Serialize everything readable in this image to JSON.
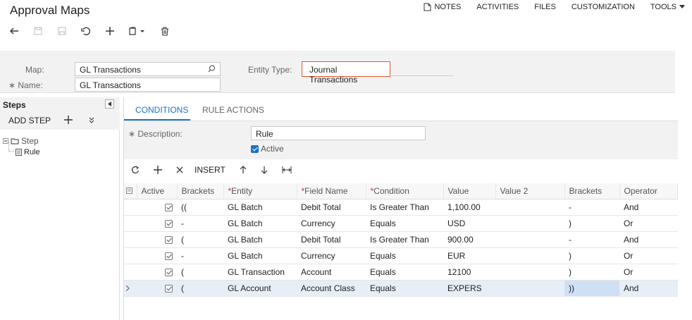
{
  "header": {
    "title": "Approval Maps",
    "menu": [
      "NOTES",
      "ACTIVITIES",
      "FILES",
      "CUSTOMIZATION",
      "TOOLS"
    ]
  },
  "form": {
    "map_label": "Map:",
    "map_value": "GL Transactions",
    "name_label": "Name:",
    "name_value": "GL Transactions",
    "entity_type_label": "Entity Type:",
    "entity_type_value": "Journal Transactions"
  },
  "steps": {
    "title": "Steps",
    "add_step_label": "ADD STEP",
    "tree_step": "Step",
    "tree_rule": "Rule"
  },
  "tabs": [
    "CONDITIONS",
    "RULE ACTIONS"
  ],
  "conditions": {
    "description_label": "Description:",
    "description_value": "Rule",
    "active_label": "Active",
    "insert_label": "INSERT"
  },
  "grid": {
    "columns": [
      "Active",
      "Brackets",
      "Entity",
      "Field Name",
      "Condition",
      "Value",
      "Value 2",
      "Brackets",
      "Operator"
    ],
    "rows": [
      {
        "brackets_open": "((",
        "entity": "GL Batch",
        "field": "Debit Total",
        "condition": "Is Greater Than",
        "value": "1,100.00",
        "value2": "",
        "brackets_close": "-",
        "operator": "And"
      },
      {
        "brackets_open": "-",
        "entity": "GL Batch",
        "field": "Currency",
        "condition": "Equals",
        "value": "USD",
        "value2": "",
        "brackets_close": ")",
        "operator": "Or"
      },
      {
        "brackets_open": "(",
        "entity": "GL Batch",
        "field": "Debit Total",
        "condition": "Is Greater Than",
        "value": "900.00",
        "value2": "",
        "brackets_close": "-",
        "operator": "And"
      },
      {
        "brackets_open": "-",
        "entity": "GL Batch",
        "field": "Currency",
        "condition": "Equals",
        "value": "EUR",
        "value2": "",
        "brackets_close": ")",
        "operator": "Or"
      },
      {
        "brackets_open": "(",
        "entity": "GL Transaction",
        "field": "Account",
        "condition": "Equals",
        "value": "12100",
        "value2": "",
        "brackets_close": ")",
        "operator": "Or"
      },
      {
        "brackets_open": "(",
        "entity": "GL Account",
        "field": "Account Class",
        "condition": "Equals",
        "value": "EXPERS",
        "value2": "",
        "brackets_close": "))",
        "operator": "And"
      }
    ]
  },
  "colors": {
    "accent": "#1a72c9",
    "highlight_border": "#e2572b"
  }
}
